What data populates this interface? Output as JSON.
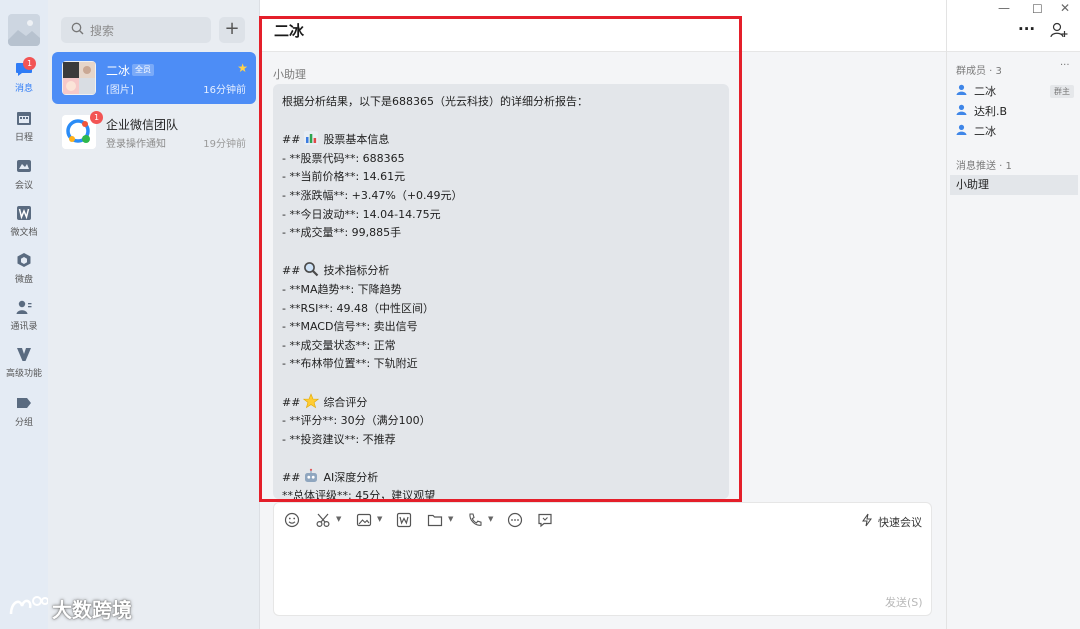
{
  "rail": {
    "items": [
      {
        "label": "消息",
        "badge": "1",
        "icon": "chat-bubble-icon",
        "active": true
      },
      {
        "label": "日程",
        "icon": "calendar-icon"
      },
      {
        "label": "会议",
        "icon": "meeting-icon"
      },
      {
        "label": "微文档",
        "icon": "doc-w-icon"
      },
      {
        "label": "微盘",
        "icon": "cloud-disk-icon"
      },
      {
        "label": "通讯录",
        "icon": "contacts-icon"
      },
      {
        "label": "高级功能",
        "icon": "advanced-v-icon"
      },
      {
        "label": "分组",
        "icon": "group-tag-icon"
      }
    ]
  },
  "conversations": {
    "search_placeholder": "搜索",
    "add_label": "+",
    "items": [
      {
        "name": "二冰",
        "tag": "全员",
        "preview": "[图片]",
        "time": "16分钟前",
        "starred": true,
        "active": true
      },
      {
        "name": "企业微信团队",
        "preview": "登录操作通知",
        "time": "19分钟前",
        "badge": "1"
      }
    ]
  },
  "chat": {
    "title": "二冰",
    "sender": "小助理",
    "message_lines": [
      "根据分析结果，以下是688365（光云科技）的详细分析报告：",
      "",
      "## [chart] 股票基本信息",
      "- **股票代码**: 688365",
      "- **当前价格**: 14.61元",
      "- **涨跌幅**: +3.47%（+0.49元）",
      "- **今日波动**: 14.04-14.75元",
      "- **成交量**: 99,885手",
      "",
      "## [search] 技术指标分析",
      "- **MA趋势**: 下降趋势",
      "- **RSI**: 49.48（中性区间）",
      "- **MACD信号**: 卖出信号",
      "- **成交量状态**: 正常",
      "- **布林带位置**: 下轨附近",
      "",
      "## [star] 综合评分",
      "- **评分**: 30分（满分100）",
      "- **投资建议**: 不推荐",
      "",
      "## [robot] AI深度分析",
      "**总体评级**: 45分，建议观望"
    ],
    "msg": {
      "intro": "根据分析结果，以下是688365（光云科技）的详细分析报告：",
      "h1_prefix": "##",
      "h1": "股票基本信息",
      "l1": "- **股票代码**: 688365",
      "l2": "- **当前价格**: 14.61元",
      "l3": "- **涨跌幅**: +3.47%（+0.49元）",
      "l4": "- **今日波动**: 14.04-14.75元",
      "l5": "- **成交量**: 99,885手",
      "h2_prefix": "##",
      "h2": "技术指标分析",
      "l6": "- **MA趋势**: 下降趋势",
      "l7": "- **RSI**: 49.48（中性区间）",
      "l8": "- **MACD信号**: 卖出信号",
      "l9": "- **成交量状态**: 正常",
      "l10": "- **布林带位置**: 下轨附近",
      "h3_prefix": "##",
      "h3": "综合评分",
      "l11": "- **评分**: 30分（满分100）",
      "l12": "- **投资建议**: 不推荐",
      "h4_prefix": "##",
      "h4": "AI深度分析",
      "l13": "**总体评级**: 45分，建议观望"
    },
    "composer": {
      "quick_meeting": "快速会议",
      "send": "发送(S)"
    }
  },
  "right_panel": {
    "members_header": "群成员 · 3",
    "more": "···",
    "members": [
      {
        "name": "二冰",
        "role": "群主"
      },
      {
        "name": "达利.B"
      },
      {
        "name": "二冰"
      }
    ],
    "push_header": "消息推送 · 1",
    "push_item": "小助理"
  },
  "header_actions": {
    "more": "···"
  },
  "watermark": "大数跨境",
  "colors": {
    "accent": "#4d8df6",
    "badge": "#f25454",
    "highlight": "#e41f2a"
  }
}
